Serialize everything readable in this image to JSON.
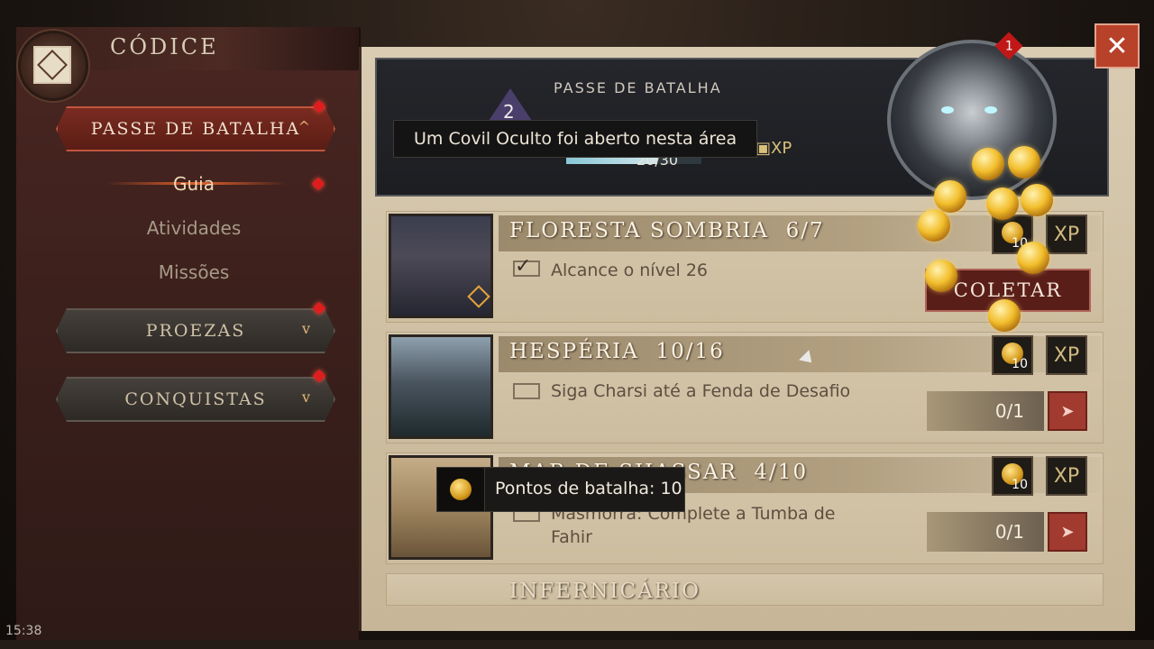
{
  "header": {
    "title": "CÓDICE",
    "close_label": "✕"
  },
  "sidebar": {
    "items": [
      {
        "label": "PASSE DE BATALHA",
        "chevron": "^",
        "active": true
      },
      {
        "label": "PROEZAS",
        "chevron": "v",
        "active": false
      },
      {
        "label": "CONQUISTAS",
        "chevron": "v",
        "active": false
      }
    ],
    "sub_items": [
      {
        "label": "Guia",
        "current": true
      },
      {
        "label": "Atividades",
        "current": false
      },
      {
        "label": "Missões",
        "current": false
      }
    ]
  },
  "battle_pass": {
    "title": "PASSE DE BATALHA",
    "level": "2",
    "progress_text": "20/30",
    "progress_fraction": 0.67,
    "chest_label": "XP",
    "notification_count": "1"
  },
  "tooltips": {
    "dungeon": "Um Covil Oculto foi aberto nesta área",
    "points": "Pontos de batalha: 10"
  },
  "quests": [
    {
      "title": "FLORESTA SOMBRIA",
      "progress": "6/7",
      "objective": "Alcance o nível 26",
      "completed": true,
      "reward_points": "10",
      "reward_xp": "XP",
      "action_label": "COLETAR"
    },
    {
      "title": "HESPÉRIA",
      "progress": "10/16",
      "objective": "Siga Charsi até a Fenda de Desafio",
      "completed": false,
      "reward_points": "10",
      "reward_xp": "XP",
      "status": "0/1"
    },
    {
      "title": "MAR DE SHASSAR",
      "progress": "4/10",
      "objective": "Masmorra: Complete a Tumba de Fahir",
      "completed": false,
      "reward_points": "10",
      "reward_xp": "XP",
      "status": "0/1"
    },
    {
      "title": "INFERNICÁRIO"
    }
  ],
  "colors": {
    "accent_red": "#a13a2f",
    "gold": "#f2be2c",
    "parchment": "#d4c6ab"
  },
  "clock": "15:38"
}
